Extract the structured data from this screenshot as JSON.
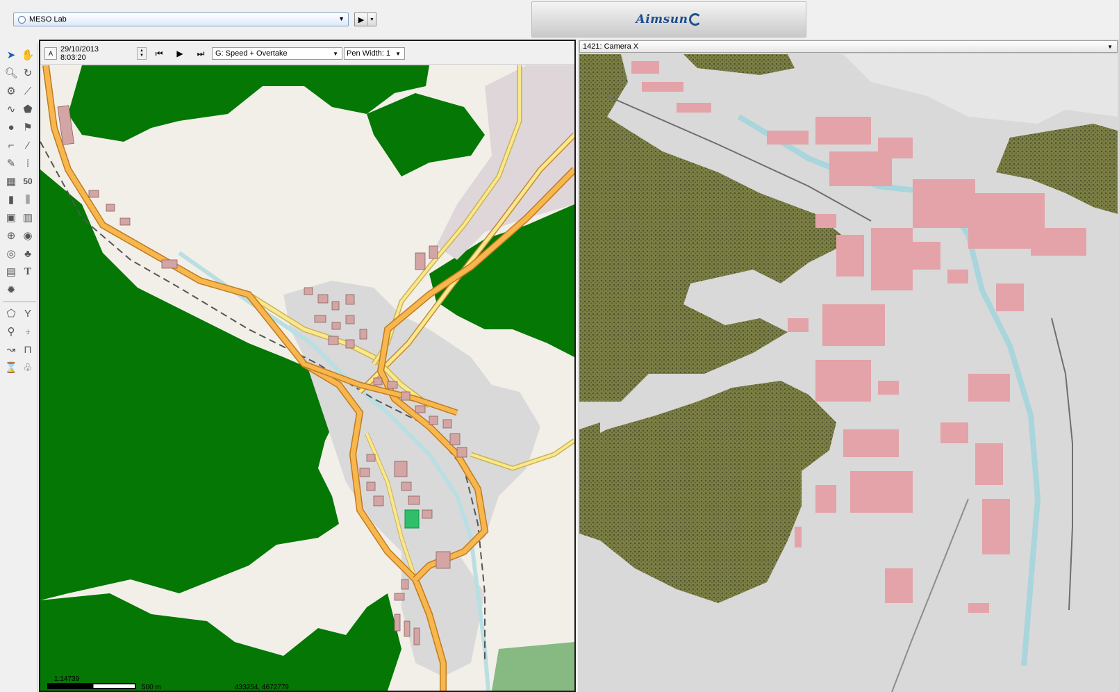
{
  "topbar": {
    "scenario_label": "MESO Lab",
    "run_icon": "play-icon",
    "logo_text": "Aimsun"
  },
  "toolbox": {
    "tools": [
      "select-arrow",
      "pan-hand",
      "zoom",
      "rotate",
      "node",
      "polyline",
      "bezier",
      "polygon",
      "circle",
      "flag",
      "connector",
      "edge",
      "pencil",
      "lanes",
      "detector",
      "speed-sign",
      "meter",
      "bars",
      "bus",
      "stripes",
      "crossing",
      "target",
      "rotary",
      "tree",
      "layer",
      "text",
      "gear",
      "centroid",
      "connector-y",
      "pin",
      "pin-down",
      "turn",
      "bus-stop",
      "hourglass",
      "tree-small"
    ],
    "extra": {
      "speed_sign_text": "50",
      "text_tool": "T"
    }
  },
  "map": {
    "anchor_label": "A",
    "datetime": "29/10/2013 8:03:20",
    "style_value": "G: Speed + Overtake",
    "pen_width": "Pen Width: 1",
    "scale_ratio": "1:14739",
    "scale_label": "500 m",
    "coords": "433254, 4672779"
  },
  "view3d": {
    "camera": "1421: Camera X"
  },
  "colors": {
    "forest": "#047704",
    "land": "#f2efe9",
    "urban": "#d9d9d9",
    "road_major": "#f7b74e",
    "road_minor": "#fbe88a",
    "building": "#d4a5a5",
    "river": "#b9dfe3",
    "terrain_3d": "#7c7f45"
  }
}
